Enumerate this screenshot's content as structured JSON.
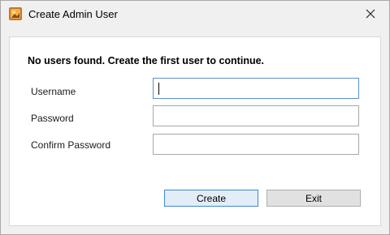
{
  "window": {
    "title": "Create Admin User",
    "close_icon": "close-icon",
    "app_icon": "app-icon"
  },
  "form": {
    "heading": "No users found. Create the first user to continue.",
    "username_label": "Username",
    "username_value": "",
    "password_label": "Password",
    "password_value": "",
    "confirm_label": "Confirm Password",
    "confirm_value": ""
  },
  "buttons": {
    "create_label": "Create",
    "exit_label": "Exit"
  },
  "colors": {
    "focus_border": "#5b8fd0",
    "primary_button_border": "#3f86d4",
    "primary_button_bg": "#e3edf8"
  }
}
